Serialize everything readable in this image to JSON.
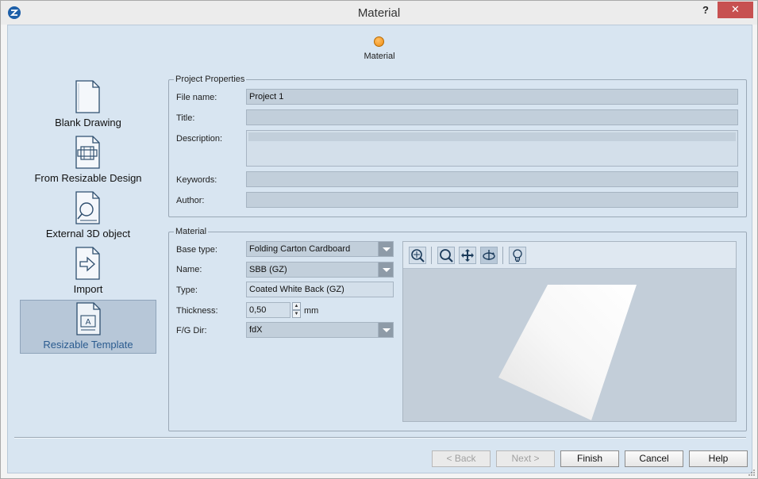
{
  "window": {
    "title": "Material",
    "help_glyph": "?",
    "close_glyph": "✕"
  },
  "wizard": {
    "step_label": "Material"
  },
  "nav": {
    "items": [
      {
        "label": "Blank Drawing",
        "icon": "blank-document-icon"
      },
      {
        "label": "From Resizable Design",
        "icon": "resizable-design-icon"
      },
      {
        "label": "External 3D object",
        "icon": "magnifier-document-icon"
      },
      {
        "label": "Import",
        "icon": "import-arrow-icon"
      },
      {
        "label": "Resizable Template",
        "icon": "template-document-icon",
        "selected": true
      }
    ]
  },
  "project_properties": {
    "legend": "Project Properties",
    "file_name_label": "File name:",
    "file_name_value": "Project 1",
    "title_label": "Title:",
    "title_value": "",
    "description_label": "Description:",
    "description_value": "",
    "keywords_label": "Keywords:",
    "keywords_value": "",
    "author_label": "Author:",
    "author_value": ""
  },
  "material": {
    "legend": "Material",
    "base_type_label": "Base type:",
    "base_type_value": "Folding Carton Cardboard",
    "name_label": "Name:",
    "name_value": "SBB (GZ)",
    "type_label": "Type:",
    "type_value": "Coated White Back (GZ)",
    "thickness_label": "Thickness:",
    "thickness_value": "0,50",
    "thickness_unit": "mm",
    "fg_dir_label": "F/G Dir:",
    "fg_dir_value": "fdX"
  },
  "preview_toolbar": [
    "zoom-fit-icon",
    "zoom-icon",
    "pan-icon",
    "rotate-icon",
    "light-bulb-icon"
  ],
  "buttons": {
    "back": "< Back",
    "next": "Next >",
    "finish": "Finish",
    "cancel": "Cancel",
    "help": "Help"
  },
  "colors": {
    "content_bg": "#d8e5f1",
    "step_dot": "#f08c10",
    "close_red": "#c75050"
  }
}
